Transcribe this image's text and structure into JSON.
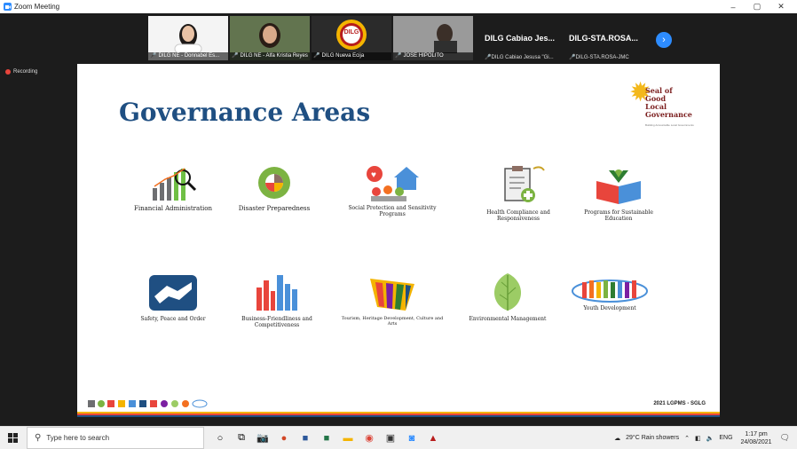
{
  "window": {
    "title": "Zoom Meeting",
    "controls": [
      "–",
      "▢",
      "✕"
    ]
  },
  "participants": [
    {
      "name": "DILG NE - Donnabel Es...",
      "kind": "woman"
    },
    {
      "name": "DILG NE - Alfa Kristia Reyes",
      "kind": "woman2"
    },
    {
      "name": "DILG Nueva Ecija",
      "kind": "logo",
      "logo_text": "DILG"
    },
    {
      "name": "JOSE HIPOLITO",
      "kind": "man"
    }
  ],
  "name_tiles": [
    {
      "big": "DILG Cabiao Jes...",
      "small": "DILG Cabiao Jesusa \"Gi..."
    },
    {
      "big": "DILG-STA.ROSA...",
      "small": "DILG-STA.ROSA-JMC"
    }
  ],
  "recording_label": "Recording",
  "slide": {
    "title": "Governance Areas",
    "seal": {
      "lines": [
        "Seal of",
        "Good",
        "Local",
        "Governance"
      ],
      "subtitle": "Building Accountable Local Governments"
    },
    "areas": [
      {
        "label": "Financial Administration",
        "icon": "chart-magnifier-icon"
      },
      {
        "label": "Disaster Preparedness",
        "icon": "disaster-wheel-icon"
      },
      {
        "label": "Social Protection and Sensitivity Programs",
        "icon": "family-house-icon"
      },
      {
        "label": "Health Compliance and Responsiveness",
        "icon": "clipboard-caduceus-icon"
      },
      {
        "label": "Programs for Sustainable Education",
        "icon": "book-person-icon"
      },
      {
        "label": "Safety, Peace and Order",
        "icon": "handshake-icon"
      },
      {
        "label": "Business-Friendliness and Competitiveness",
        "icon": "skyline-icon"
      },
      {
        "label": "Tourism, Heritage Development, Culture and Arts",
        "icon": "colorful-banner-icon"
      },
      {
        "label": "Environmental Management",
        "icon": "leaf-icon"
      },
      {
        "label": "Youth Development",
        "icon": "youth-circle-icon"
      }
    ],
    "footer_text": "2021 LGPMS - SGLG"
  },
  "taskbar": {
    "search_placeholder": "Type here to search",
    "weather": "29°C  Rain showers",
    "lang": "ENG",
    "time": "1:17 pm",
    "date": "24/08/2021"
  }
}
